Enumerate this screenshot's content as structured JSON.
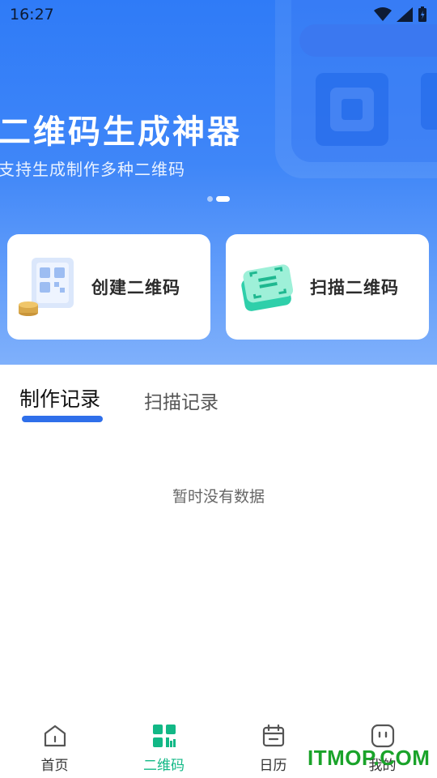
{
  "status_bar": {
    "time": "16:27"
  },
  "hero": {
    "title": "二维码生成神器",
    "subtitle": "支持生成制作多种二维码",
    "carousel": {
      "count": 2,
      "active_index": 1
    }
  },
  "action_cards": [
    {
      "label": "创建二维码",
      "icon": "create-qr-icon"
    },
    {
      "label": "扫描二维码",
      "icon": "scan-qr-icon"
    }
  ],
  "record_tabs": [
    {
      "label": "制作记录",
      "active": true
    },
    {
      "label": "扫描记录",
      "active": false
    }
  ],
  "empty_state": {
    "text": "暂时没有数据"
  },
  "bottom_nav": [
    {
      "label": "首页",
      "icon": "home-icon",
      "active": false
    },
    {
      "label": "二维码",
      "icon": "qr-code-icon",
      "active": true
    },
    {
      "label": "日历",
      "icon": "calendar-icon",
      "active": false
    },
    {
      "label": "我的",
      "icon": "profile-icon",
      "active": false
    }
  ],
  "watermark": {
    "text": "ITMOP.COM"
  },
  "colors": {
    "primary_blue": "#2f7bf7",
    "tab_indicator": "#2f6fea",
    "nav_active": "#12b886",
    "watermark": "#1aa32a"
  }
}
